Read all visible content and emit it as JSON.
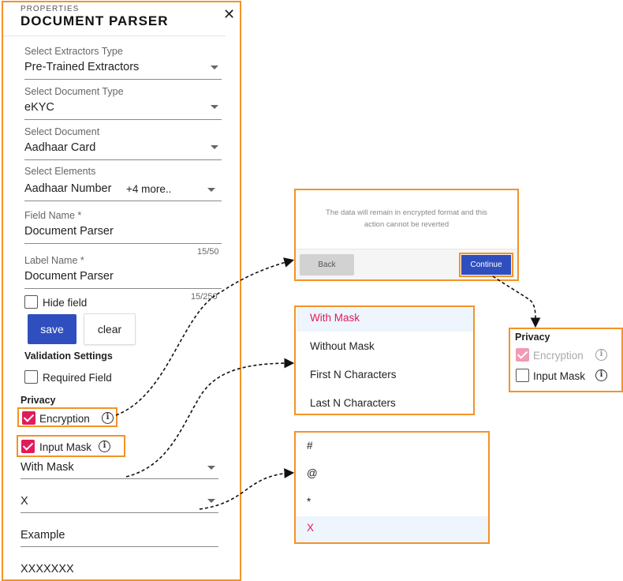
{
  "panel": {
    "subheading": "PROPERTIES",
    "title": "DOCUMENT PARSER",
    "fields": {
      "extractors_type": {
        "label": "Select Extractors Type",
        "value": "Pre-Trained Extractors"
      },
      "document_type": {
        "label": "Select Document Type",
        "value": "eKYC"
      },
      "document": {
        "label": "Select Document",
        "value": "Aadhaar Card"
      },
      "elements": {
        "label": "Select Elements",
        "value": "Aadhaar Number",
        "more": "+4 more.."
      },
      "field_name": {
        "label": "Field Name *",
        "value": "Document Parser",
        "counter": "15/50"
      },
      "label_name": {
        "label": "Label Name *",
        "value": "Document Parser",
        "counter": "15/250"
      }
    },
    "hide_field": "Hide field",
    "save_label": "save",
    "clear_label": "clear",
    "validation_heading": "Validation Settings",
    "required_field": "Required Field",
    "privacy_heading": "Privacy",
    "encryption": "Encryption",
    "input_mask": "Input Mask",
    "info_glyph": "i",
    "mask_type_value": "With Mask",
    "mask_char_value": "X",
    "example_label": "Example",
    "example_value": "XXXXXXX"
  },
  "dialog": {
    "message_line1": "The data will remain in encrypted format and this",
    "message_line2": "action cannot be reverted",
    "back_label": "Back",
    "continue_label": "Continue"
  },
  "mask_options": [
    "With Mask",
    "Without Mask",
    "First N Characters",
    "Last N Characters"
  ],
  "char_options": [
    "#",
    "@",
    "*",
    "X"
  ],
  "privacy_card": {
    "heading": "Privacy",
    "encryption": "Encryption",
    "input_mask": "Input Mask"
  },
  "colors": {
    "accent_orange": "#f39327",
    "primary_blue": "#2f4fbe",
    "checkbox_pink": "#e31a5a",
    "highlight_bg": "#eef5fc"
  },
  "icons": [
    "close-icon",
    "chevron-down-icon",
    "info-icon",
    "checkmark-icon"
  ]
}
